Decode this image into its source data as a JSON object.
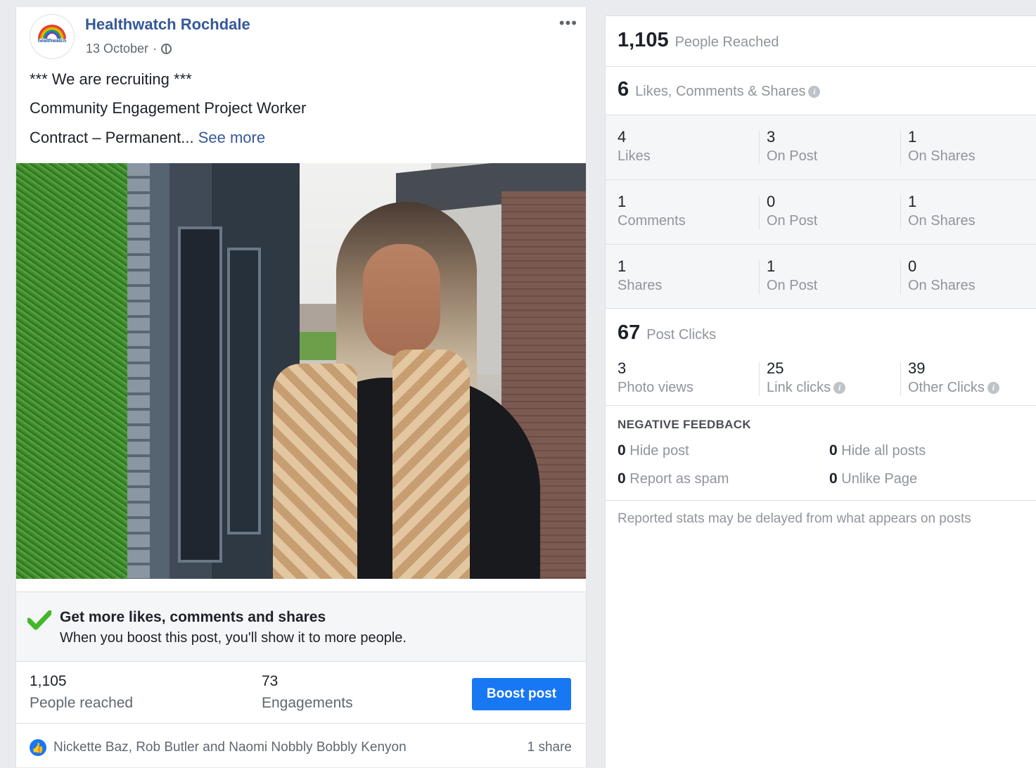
{
  "post": {
    "page_name": "Healthwatch Rochdale",
    "avatar_text": "healthwatch",
    "date": "13 October",
    "date_separator": "·",
    "more_label": "•••",
    "text_line1": "*** We are recruiting ***",
    "text_line2": "Community Engagement Project Worker",
    "text_line3": "Contract – Permanent...",
    "see_more": "See more"
  },
  "boost": {
    "title": "Get more likes, comments and shares",
    "subtitle": "When you boost this post, you'll show it to more people.",
    "reached_value": "1,105",
    "reached_label": "People reached",
    "engagements_value": "73",
    "engagements_label": "Engagements",
    "button_label": "Boost post"
  },
  "footer": {
    "reactors": "Nickette Baz, Rob Butler and Naomi Nobbly Bobbly Kenyon",
    "shares": "1 share"
  },
  "insights": {
    "reach_value": "1,105",
    "reach_label": "People Reached",
    "engagement_value": "6",
    "engagement_label": "Likes, Comments & Shares",
    "likes": {
      "total": "4",
      "total_label": "Likes",
      "post": "3",
      "post_label": "On Post",
      "shares": "1",
      "shares_label": "On Shares"
    },
    "comments": {
      "total": "1",
      "total_label": "Comments",
      "post": "0",
      "post_label": "On Post",
      "shares": "1",
      "shares_label": "On Shares"
    },
    "shares": {
      "total": "1",
      "total_label": "Shares",
      "post": "1",
      "post_label": "On Post",
      "shares": "0",
      "shares_label": "On Shares"
    },
    "clicks_value": "67",
    "clicks_label": "Post Clicks",
    "photo_views_value": "3",
    "photo_views_label": "Photo views",
    "link_clicks_value": "25",
    "link_clicks_label": "Link clicks",
    "other_clicks_value": "39",
    "other_clicks_label": "Other Clicks",
    "negative_title": "NEGATIVE FEEDBACK",
    "hide_post_value": "0",
    "hide_post_label": "Hide post",
    "hide_all_value": "0",
    "hide_all_label": "Hide all posts",
    "spam_value": "0",
    "spam_label": "Report as spam",
    "unlike_value": "0",
    "unlike_label": "Unlike Page",
    "disclaimer": "Reported stats may be delayed from what appears on posts",
    "info_glyph": "i"
  },
  "colors": {
    "link_blue": "#365899",
    "button_blue": "#1877f2",
    "check_green": "#42b72a"
  }
}
